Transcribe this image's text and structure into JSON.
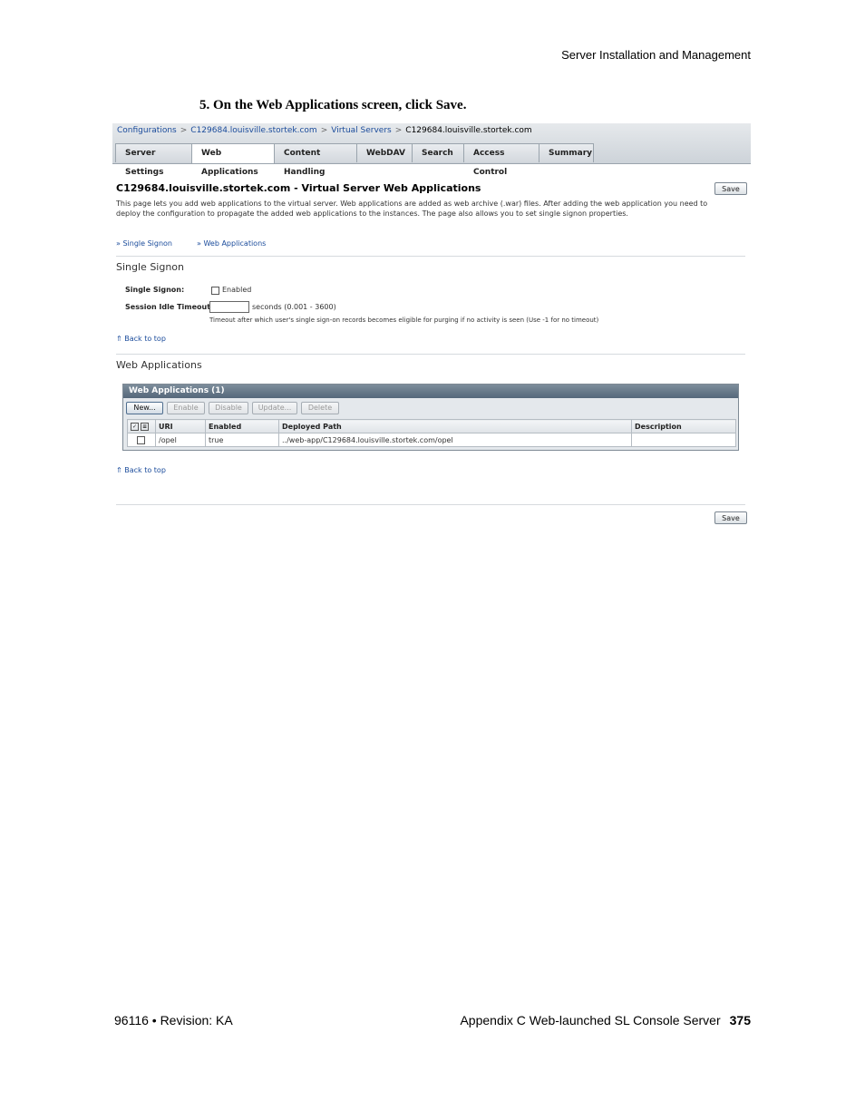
{
  "running_head": "Server Installation and Management",
  "step": "5.  On the Web Applications screen, click Save.",
  "breadcrumb": {
    "items": [
      "Configurations",
      "C129684.louisville.stortek.com",
      "Virtual Servers",
      "C129684.louisville.stortek.com"
    ],
    "separator": ">"
  },
  "tabs": [
    {
      "label": "Server Settings"
    },
    {
      "label": "Web Applications"
    },
    {
      "label": "Content Handling"
    },
    {
      "label": "WebDAV"
    },
    {
      "label": "Search"
    },
    {
      "label": "Access Control"
    },
    {
      "label": "Summary"
    }
  ],
  "page": {
    "title": "C129684.louisville.stortek.com - Virtual Server Web Applications",
    "description": "This page lets you add web applications to the virtual server. Web applications are added as web archive (.war) files. After adding the web application you need to deploy the configuration to propagate the added web applications to the instances. The page also allows you to set single signon properties.",
    "save_label": "Save",
    "jump_links": [
      "Single Signon",
      "Web Applications"
    ],
    "back_to_top": "Back to top"
  },
  "single_signon": {
    "title": "Single Signon",
    "sso_label": "Single Signon:",
    "enabled_label": "Enabled",
    "timeout_label": "Session Idle Timeout:",
    "timeout_value": "",
    "timeout_unit": "seconds (0.001 - 3600)",
    "timeout_help": "Timeout after which user's single sign-on records becomes eligible for purging if no activity is seen (Use -1 for no timeout)"
  },
  "web_apps": {
    "section_title": "Web Applications",
    "table_title": "Web Applications (1)",
    "buttons": {
      "new": "New...",
      "enable": "Enable",
      "disable": "Disable",
      "update": "Update...",
      "delete": "Delete"
    },
    "columns": {
      "uri": "URI",
      "enabled": "Enabled",
      "path": "Deployed Path",
      "description": "Description"
    },
    "rows": [
      {
        "uri": "/opel",
        "enabled": "true",
        "path": "../web-app/C129684.louisville.stortek.com/opel",
        "description": ""
      }
    ]
  },
  "footer": {
    "doc": "96116 • Revision: KA",
    "chapter": "Appendix C Web-launched SL Console Server",
    "page_number": "375"
  }
}
